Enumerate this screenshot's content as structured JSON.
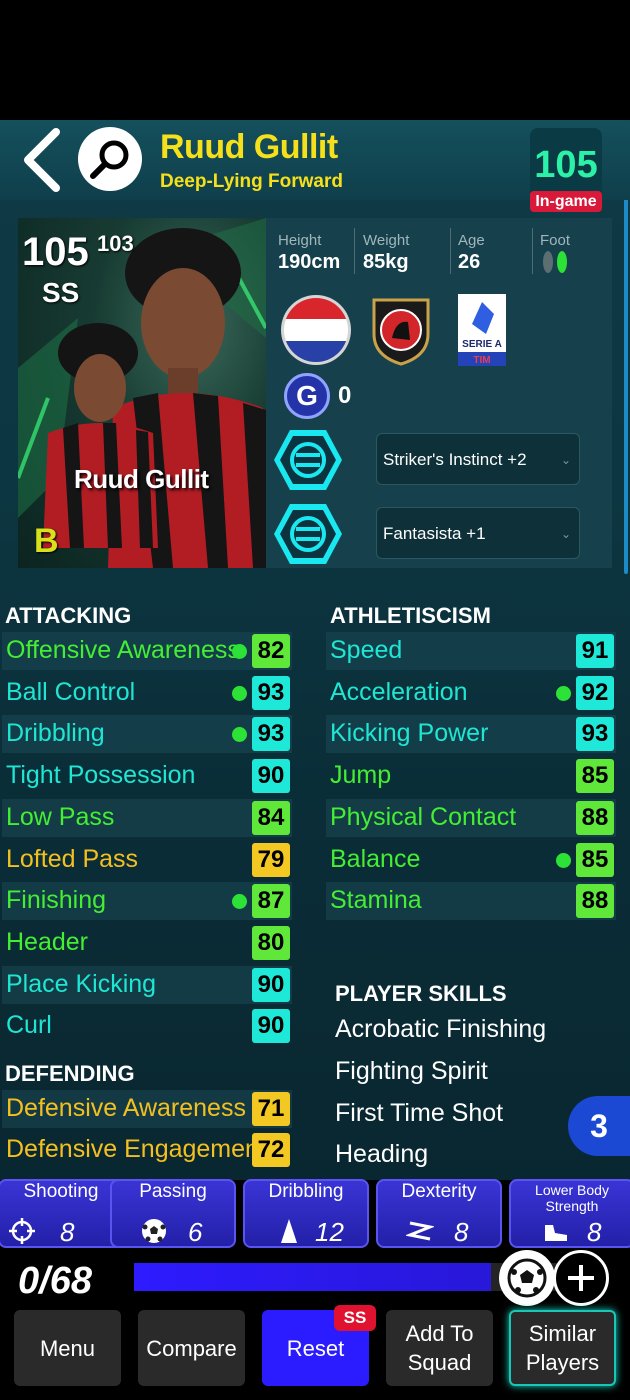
{
  "header": {
    "player_name": "Ruud Gullit",
    "role": "Deep-Lying Forward",
    "rating": "105",
    "rating_badge": "In-game"
  },
  "card": {
    "overall": "105",
    "boost_overall": "103",
    "tier": "SS",
    "name": "Ruud Gullit",
    "grade": "B"
  },
  "physical": {
    "height_label": "Height",
    "height": "190cm",
    "weight_label": "Weight",
    "weight": "85kg",
    "age_label": "Age",
    "age": "26",
    "foot_label": "Foot"
  },
  "club": {
    "league_text": "SERIE A",
    "league_sponsor": "TIM"
  },
  "g_count": "0",
  "additional_skills": [
    "Striker's Instinct +2",
    "Fantasista +1"
  ],
  "attacking": {
    "title": "ATTACKING",
    "stats": [
      {
        "name": "Offensive Awareness",
        "value": "82",
        "dot": true
      },
      {
        "name": "Ball Control",
        "value": "93",
        "dot": true
      },
      {
        "name": "Dribbling",
        "value": "93",
        "dot": true
      },
      {
        "name": "Tight Possession",
        "value": "90",
        "dot": false
      },
      {
        "name": "Low Pass",
        "value": "84",
        "dot": false
      },
      {
        "name": "Lofted Pass",
        "value": "79",
        "dot": false
      },
      {
        "name": "Finishing",
        "value": "87",
        "dot": true
      },
      {
        "name": "Header",
        "value": "80",
        "dot": false
      },
      {
        "name": "Place Kicking",
        "value": "90",
        "dot": false
      },
      {
        "name": "Curl",
        "value": "90",
        "dot": false
      }
    ]
  },
  "defending": {
    "title": "DEFENDING",
    "stats": [
      {
        "name": "Defensive Awareness",
        "value": "71",
        "dot": false
      },
      {
        "name": "Defensive Engagement",
        "value": "72",
        "dot": false
      }
    ]
  },
  "athleticism": {
    "title": "ATHLETISCISM",
    "stats": [
      {
        "name": "Speed",
        "value": "91",
        "dot": false
      },
      {
        "name": "Acceleration",
        "value": "92",
        "dot": true
      },
      {
        "name": "Kicking Power",
        "value": "93",
        "dot": false
      },
      {
        "name": "Jump",
        "value": "85",
        "dot": false
      },
      {
        "name": "Physical Contact",
        "value": "88",
        "dot": false
      },
      {
        "name": "Balance",
        "value": "85",
        "dot": true
      },
      {
        "name": "Stamina",
        "value": "88",
        "dot": false
      }
    ]
  },
  "player_skills": {
    "title": "PLAYER SKILLS",
    "items": [
      "Acrobatic Finishing",
      "Fighting Spirit",
      "First Time Shot",
      "Heading"
    ],
    "more_count": "3"
  },
  "boosts": [
    {
      "label": "Shooting",
      "value": "8",
      "icon": "crosshair-icon"
    },
    {
      "label": "Passing",
      "value": "6",
      "icon": "ball-icon"
    },
    {
      "label": "Dribbling",
      "value": "12",
      "icon": "cone-icon"
    },
    {
      "label": "Dexterity",
      "value": "8",
      "icon": "zigzag-icon"
    },
    {
      "label": "Lower Body Strength",
      "value": "8",
      "icon": "boot-icon"
    }
  ],
  "progress": {
    "text": "0/68",
    "fraction": 0.76
  },
  "nav": {
    "menu": "Menu",
    "compare": "Compare",
    "reset": "Reset",
    "reset_badge": "SS",
    "add_to_squad": "Add To Squad",
    "similar_players": "Similar Players"
  },
  "colors": {
    "title_yellow": "#f5e01b",
    "stat_green_text": "#44ee33",
    "stat_cyan_text": "#1fe6d3",
    "stat_orange_text": "#f4c020",
    "val_cyan": "#1ee8d8",
    "val_green": "#5fe83a",
    "val_yellow": "#f4c822",
    "boost_blue": "#2b1bff"
  }
}
